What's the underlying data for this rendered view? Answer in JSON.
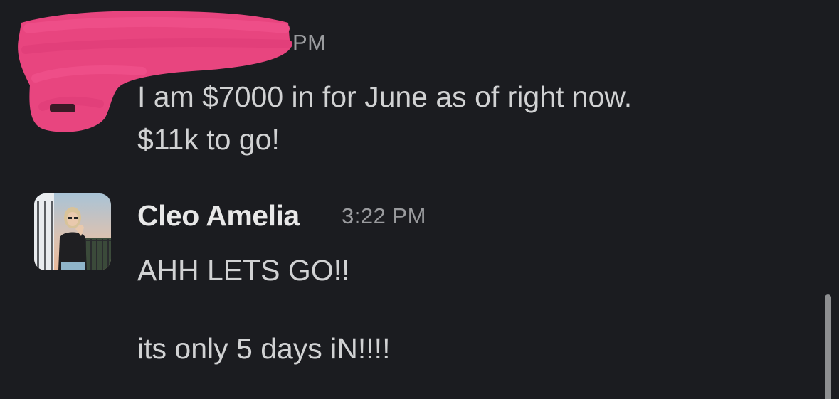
{
  "first_message": {
    "time_suffix": "PM",
    "text": "I am $7000 in for June as of right now.\n$11k to go!"
  },
  "second_message": {
    "sender": "Cleo Amelia",
    "time": "3:22 PM",
    "line_1": "AHH LETS GO!!",
    "line_2": "its only 5 days iN!!!!"
  },
  "colors": {
    "background": "#1b1c20",
    "redaction": "#e8457f",
    "text": "#d1d2d3",
    "timestamp": "#9a9b9e"
  }
}
